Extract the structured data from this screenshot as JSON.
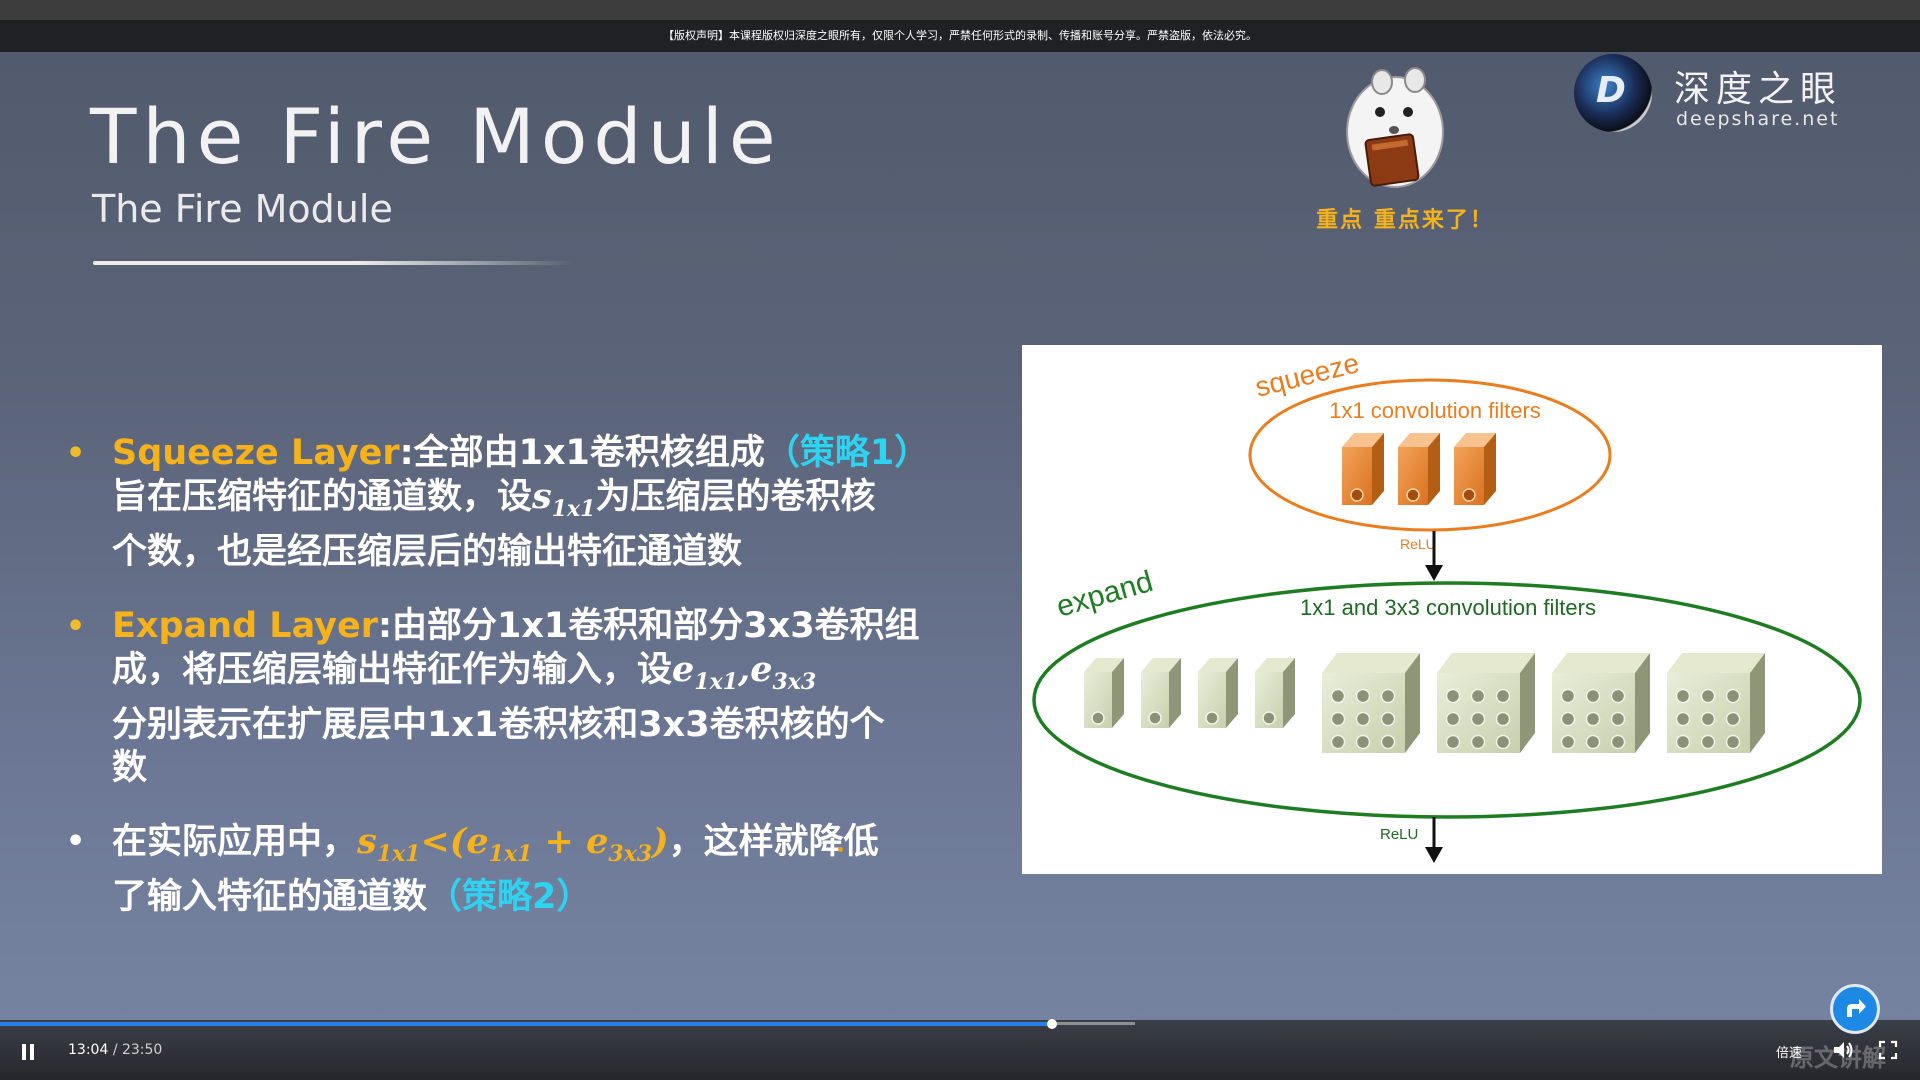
{
  "notice": "【版权声明】本课程版权归深度之眼所有，仅限个人学习，严禁任何形式的录制、传播和账号分享。严禁盗版，依法必究。",
  "slide": {
    "title": "The Fire Module",
    "subtitle": "The Fire Module",
    "mascot_caption": "重点  重点来了！",
    "logo": {
      "cn": "深度之眼",
      "en": "deepshare.net",
      "letter": "D"
    },
    "bullets": {
      "b1": {
        "head": "Squeeze Layer",
        "t1": ":全部由1x1卷积核组成",
        "tag": "（策略1）",
        "t2": "旨在压缩特征的通道数，设",
        "sym": "s",
        "sub": "1x1",
        "t3": "为压缩层的卷积核",
        "t4": "个数，也是经压缩层后的输出特征通道数"
      },
      "b2": {
        "head": "Expand Layer",
        "t1": ":由部分1x1卷积和部分3x3卷积组",
        "t2": "成，将压缩层输出特征作为输入，设",
        "sym1": "e",
        "sub1": "1x1",
        "comma": ",",
        "sym2": "e",
        "sub2": "3x3",
        "t3": "分别表示在扩展层中1x1卷积核和3x3卷积核的个",
        "t4": "数"
      },
      "b3": {
        "t1": "在实际应用中，",
        "s": "s",
        "ssub": "1x1",
        "lt": "<(",
        "e1": "e",
        "e1sub": "1x1",
        "plus": " + ",
        "e2": "e",
        "e2sub": "3x3",
        "close": ")",
        "t2": "，这样就降低",
        "t3": "了输入特征的通道数",
        "tag": "（策略2）"
      }
    },
    "figure": {
      "squeeze_label": "squeeze",
      "squeeze_filters": "1x1 convolution filters",
      "relu1": "ReLU",
      "expand_label": "expand",
      "expand_filters": "1x1 and 3x3 convolution filters",
      "relu2": "ReLU"
    }
  },
  "player": {
    "current_time": "13:04",
    "separator": "/",
    "total_time": "23:50",
    "progress": 0.547,
    "speed_label": "倍速",
    "watermark": "原文讲解"
  },
  "colors": {
    "accent_orange": "#f6b21b",
    "accent_cyan": "#2fd3f2",
    "progress_blue": "#2a7fe8",
    "squeeze_orange": "#ea7d1e",
    "expand_green": "#1e7d22"
  }
}
